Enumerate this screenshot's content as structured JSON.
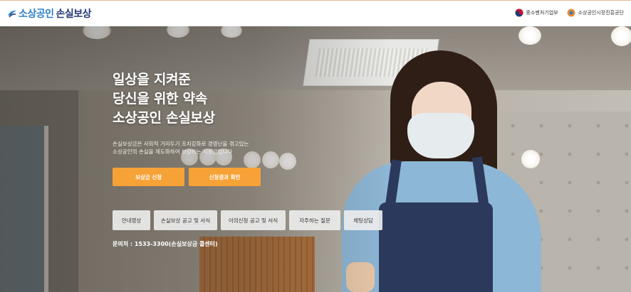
{
  "header": {
    "logo": {
      "part1": "소상공인",
      "part2": "손실보상"
    },
    "partners": [
      {
        "name": "중소벤처기업부",
        "icon": "taegeuk-emblem-icon"
      },
      {
        "name": "소상공인시장진흥공단",
        "icon": "agency-logo-icon"
      }
    ]
  },
  "hero": {
    "headline": [
      "일상을 지켜준",
      "당신을 위한 약속",
      "소상공인 손실보상"
    ],
    "description": "손실보상금은 사회적 거리두기 조치강화로 경영난을 겪고있는 소상공인의 손실을 제도화하여 보상하는 지원금입니다",
    "cta_buttons": [
      "보상금 신청",
      "신청결과 확인"
    ],
    "nav_buttons": [
      "안내영상",
      "손실보상 공고 및 서식",
      "이의신청 공고 및 서식",
      "자주하는 질문",
      "채팅상담"
    ],
    "contact": "문의처 : 1533-3300(손실보상금 콜센터)"
  },
  "colors": {
    "accent": "#f7a236",
    "brand_blue": "#2d7fc7",
    "brand_navy": "#243b78"
  }
}
